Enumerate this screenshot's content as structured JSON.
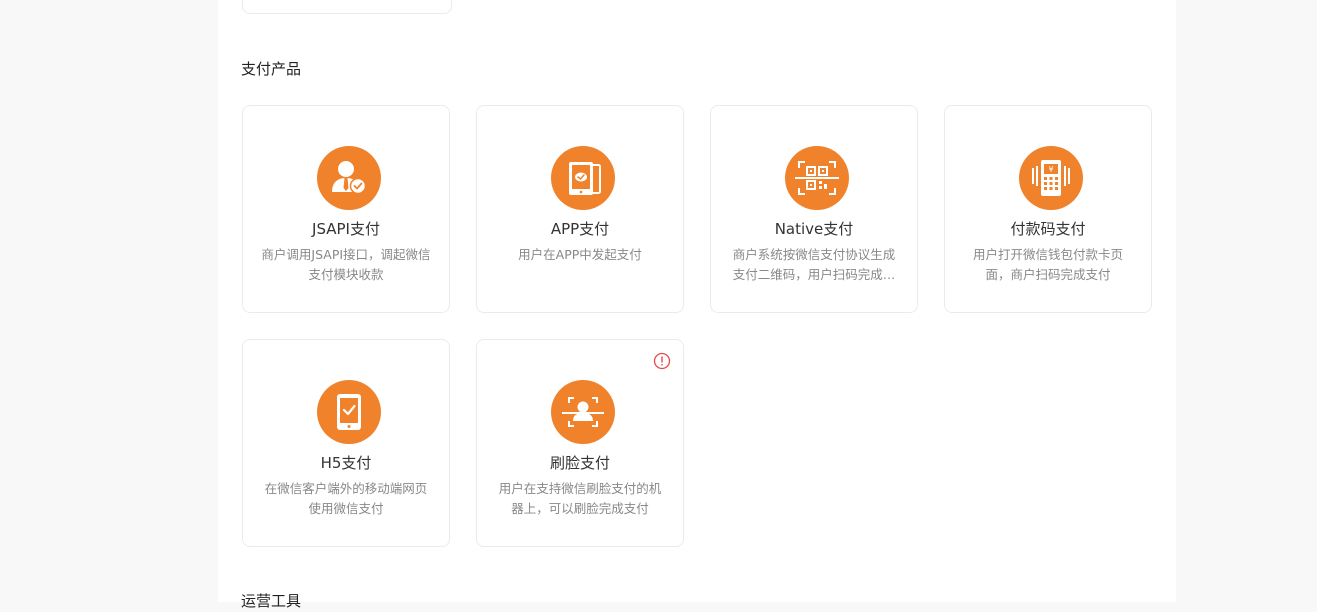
{
  "section": {
    "title": "支付产品",
    "next_title": "运营工具"
  },
  "products": [
    {
      "title": "JSAPI支付",
      "desc": "商户调用JSAPI接口，调起微信支付模块收款",
      "icon": "user-verified-icon"
    },
    {
      "title": "APP支付",
      "desc": "用户在APP中发起支付",
      "icon": "mobile-app-pay-icon"
    },
    {
      "title": "Native支付",
      "desc": "商户系统按微信支付协议生成支付二维码，用户扫码完成支付",
      "icon": "qr-code-scan-icon"
    },
    {
      "title": "付款码支付",
      "desc": "用户打开微信钱包付款卡页面，商户扫码完成支付",
      "icon": "payment-code-scanner-icon"
    },
    {
      "title": "H5支付",
      "desc": "在微信客户端外的移动端网页使用微信支付",
      "icon": "phone-check-icon"
    },
    {
      "title": "刷脸支付",
      "desc": "用户在支持微信刷脸支付的机器上，可以刷脸完成支付",
      "icon": "face-scan-icon",
      "alert": "alert-circle-icon"
    }
  ],
  "colors": {
    "accent": "#f0822b",
    "alert": "#e8474c",
    "card_border": "#ebebeb"
  }
}
